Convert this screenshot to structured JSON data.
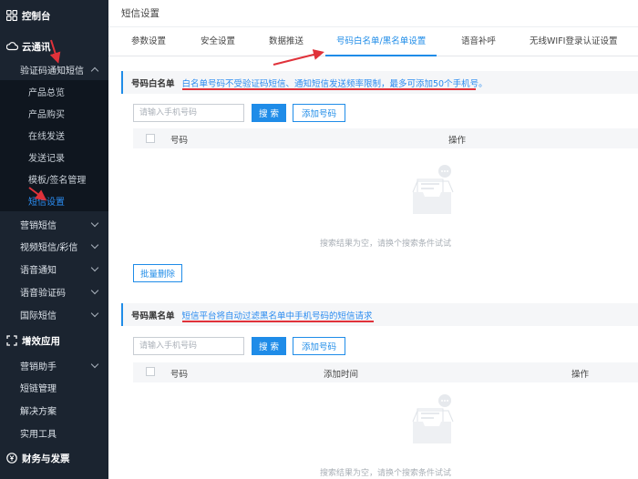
{
  "sidebar": {
    "console": "控制台",
    "yuntongxun": "云通讯",
    "sms_notify": "验证码通知短信",
    "sub_items": [
      "产品总览",
      "产品购买",
      "在线发送",
      "发送记录",
      "模板/签名管理",
      "短信设置"
    ],
    "items": [
      "营销短信",
      "视频短信/彩信",
      "语音通知",
      "语音验证码",
      "国际短信"
    ],
    "value_added": "增效应用",
    "va_items": [
      "营销助手",
      "短链管理",
      "解决方案",
      "实用工具"
    ],
    "finance": "财务与发票"
  },
  "topbar": {
    "title": "短信设置"
  },
  "tabs": [
    "参数设置",
    "安全设置",
    "数据推送",
    "号码白名单/黑名单设置",
    "语音补呼",
    "无线WIFI登录认证设置"
  ],
  "whitelist": {
    "title": "号码白名单",
    "desc": "白名单号码不受验证码短信、通知短信发送频率限制，最多可添加50个手机号。",
    "placeholder": "请输入手机号码",
    "search_btn": "搜 索",
    "add_btn": "添加号码",
    "col_number": "号码",
    "col_action": "操作",
    "empty": "搜索结果为空，请换个搜索条件试试",
    "batch_delete": "批量删除"
  },
  "blacklist": {
    "title": "号码黑名单",
    "desc": "短信平台将自动过滤黑名单中手机号码的短信请求",
    "placeholder": "请输入手机号码",
    "search_btn": "搜 索",
    "add_btn": "添加号码",
    "col_number": "号码",
    "col_time": "添加时间",
    "col_action": "操作",
    "empty": "搜索结果为空，请换个搜索条件试试"
  },
  "colors": {
    "accent": "#1f8ce8",
    "sidebar_bg": "#1b2430",
    "annotation": "#e0323a"
  }
}
